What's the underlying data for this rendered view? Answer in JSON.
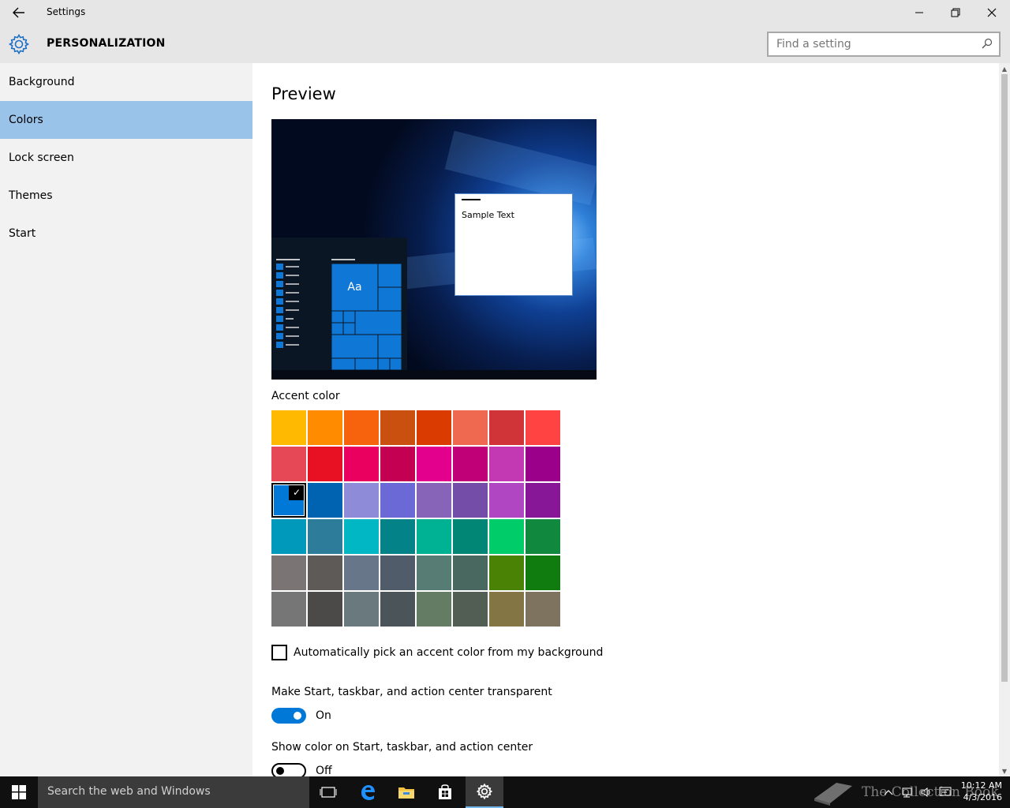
{
  "window": {
    "title": "Settings",
    "back_icon": "back-arrow-icon",
    "minimize_label": "—",
    "restore_label": "❐",
    "close_label": "✕"
  },
  "header": {
    "section_title": "PERSONALIZATION",
    "search_placeholder": "Find a setting"
  },
  "sidebar": {
    "items": [
      {
        "label": "Background",
        "active": false
      },
      {
        "label": "Colors",
        "active": true
      },
      {
        "label": "Lock screen",
        "active": false
      },
      {
        "label": "Themes",
        "active": false
      },
      {
        "label": "Start",
        "active": false
      }
    ]
  },
  "main": {
    "preview_title": "Preview",
    "preview_tile_label": "Aa",
    "preview_sample_text": "Sample Text",
    "accent_label": "Accent color",
    "accent_colors": [
      "#FFB900",
      "#FF8C00",
      "#F7630C",
      "#CA5010",
      "#DA3B01",
      "#EF6950",
      "#D13438",
      "#FF4343",
      "#E74856",
      "#E81123",
      "#EA005E",
      "#C30052",
      "#E3008C",
      "#BF0077",
      "#C239B3",
      "#9A0089",
      "#0078D7",
      "#0063B1",
      "#8E8CD8",
      "#6B69D6",
      "#8764B8",
      "#744DA9",
      "#B146C2",
      "#881798",
      "#0099BC",
      "#2D7D9A",
      "#00B7C3",
      "#038387",
      "#00B294",
      "#018574",
      "#00CC6A",
      "#10893E",
      "#7A7574",
      "#5D5A58",
      "#68768A",
      "#515C6B",
      "#567C73",
      "#486860",
      "#498205",
      "#107C10",
      "#767676",
      "#4C4A48",
      "#69797E",
      "#4A5459",
      "#647C64",
      "#525E54",
      "#847545",
      "#7E735F"
    ],
    "selected_accent_index": 16,
    "checkmark": "✓",
    "auto_pick_label": "Automatically pick an accent color from my background",
    "auto_pick_checked": false,
    "transparent_label": "Make Start, taskbar, and action center transparent",
    "transparent_state": "On",
    "show_color_label": "Show color on Start, taskbar, and action center",
    "show_color_state": "Off"
  },
  "taskbar": {
    "search_text": "Search the web and Windows",
    "icons": [
      "task-view-icon",
      "edge-icon",
      "file-explorer-icon",
      "store-icon",
      "settings-icon"
    ],
    "watermark": "The Collection Book",
    "time": "10:12 AM",
    "date": "4/3/2016"
  },
  "colors": {
    "accent": "#0078D7",
    "sidebar_selected": "#99C3E8",
    "chrome": "#E6E6E6"
  }
}
